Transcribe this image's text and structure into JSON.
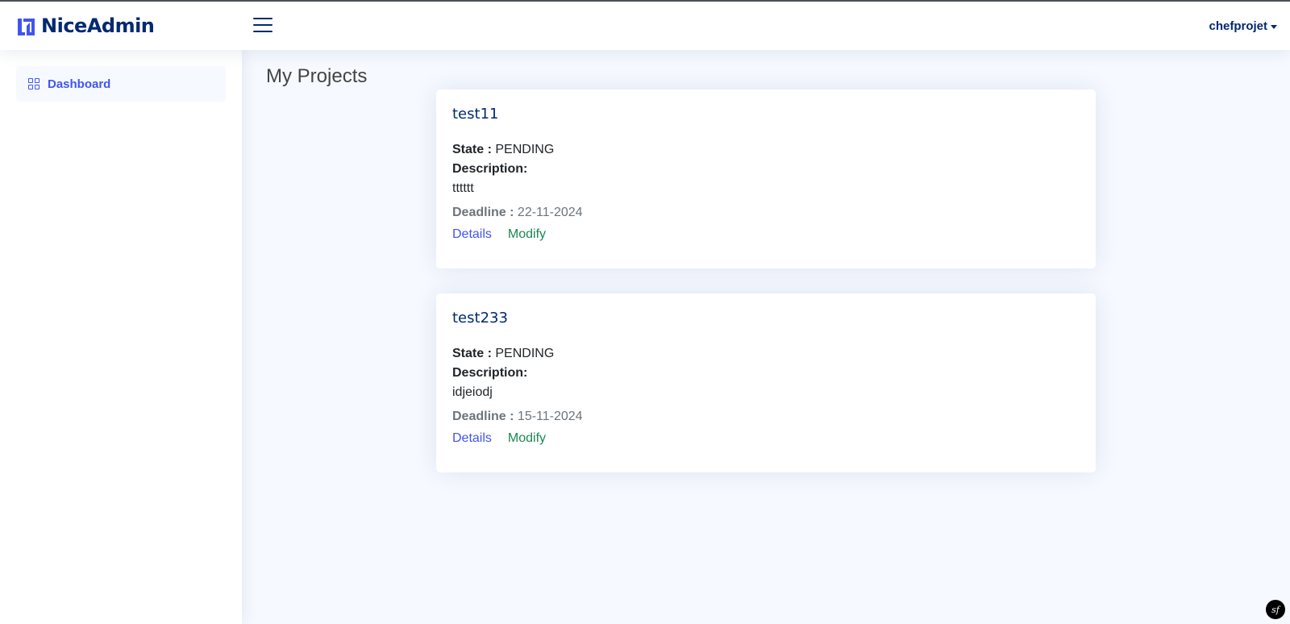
{
  "header": {
    "logo_text": "NiceAdmin",
    "user_name": "chefprojet"
  },
  "sidebar": {
    "items": [
      {
        "label": "Dashboard",
        "icon": "grid-icon"
      }
    ]
  },
  "main": {
    "title": "My Projects",
    "projects": [
      {
        "name": "test11",
        "state_label": "State :",
        "state": "PENDING",
        "description_label": "Description:",
        "description": "tttttt",
        "deadline_label": "Deadline :",
        "deadline": "22-11-2024",
        "details_label": "Details",
        "modify_label": "Modify"
      },
      {
        "name": "test233",
        "state_label": "State :",
        "state": "PENDING",
        "description_label": "Description:",
        "description": "idjeiodj",
        "deadline_label": "Deadline :",
        "deadline": "15-11-2024",
        "details_label": "Details",
        "modify_label": "Modify"
      }
    ]
  },
  "debug_toolbar": {
    "label": "sf"
  },
  "colors": {
    "brand": "#012970",
    "accent": "#4154f1",
    "modify": "#198754",
    "background": "#f6f9ff"
  }
}
